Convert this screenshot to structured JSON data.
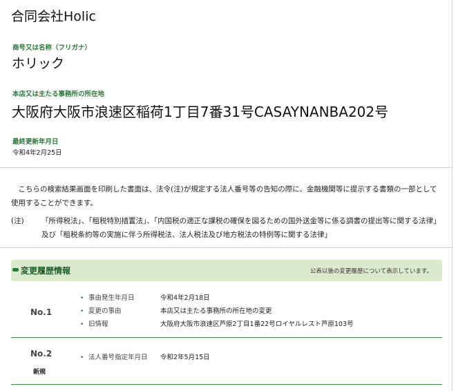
{
  "company_name": "合同会社Holic",
  "furigana": {
    "label": "商号又は名称（フリガナ）",
    "value": "ホリック"
  },
  "address": {
    "label": "本店又は主たる事務所の所在地",
    "value": "大阪府大阪市浪速区稲荷1丁目7番31号CASAYNANBA202号"
  },
  "updated": {
    "label": "最終更新年月日",
    "value": "令和4年2月25日"
  },
  "notice": {
    "body": "　こちらの検索結果画面を印刷した書面は、法令(注)が規定する法人番号等の告知の際に、金融機関等に提示する書類の一部として使用することができます。",
    "note_label": "(注)",
    "note_text": "「所得税法」、「租税特別措置法」、「内国税の適正な課税の確保を図るための国外送金等に係る調書の提出等に関する法律」及び「租税条約等の実施に伴う所得税法、法人税法及び地方税法の特例等に関する法律」"
  },
  "history": {
    "title": "変更履歴情報",
    "note": "公表以後の変更履歴について表示しています。",
    "entries": [
      {
        "no": "No.1",
        "badge": "",
        "items": [
          {
            "key": "事由発生年月日",
            "value": "令和4年2月18日"
          },
          {
            "key": "変更の事由",
            "value": "本店又は主たる事務所の所在地の変更"
          },
          {
            "key": "旧情報",
            "value": "大阪府大阪市浪速区芦原2丁目1番22号ロイヤルレスト芦原103号"
          }
        ]
      },
      {
        "no": "No.2",
        "badge": "新規",
        "items": [
          {
            "key": "法人番号指定年月日",
            "value": "令和2年5月15日"
          }
        ]
      }
    ]
  }
}
